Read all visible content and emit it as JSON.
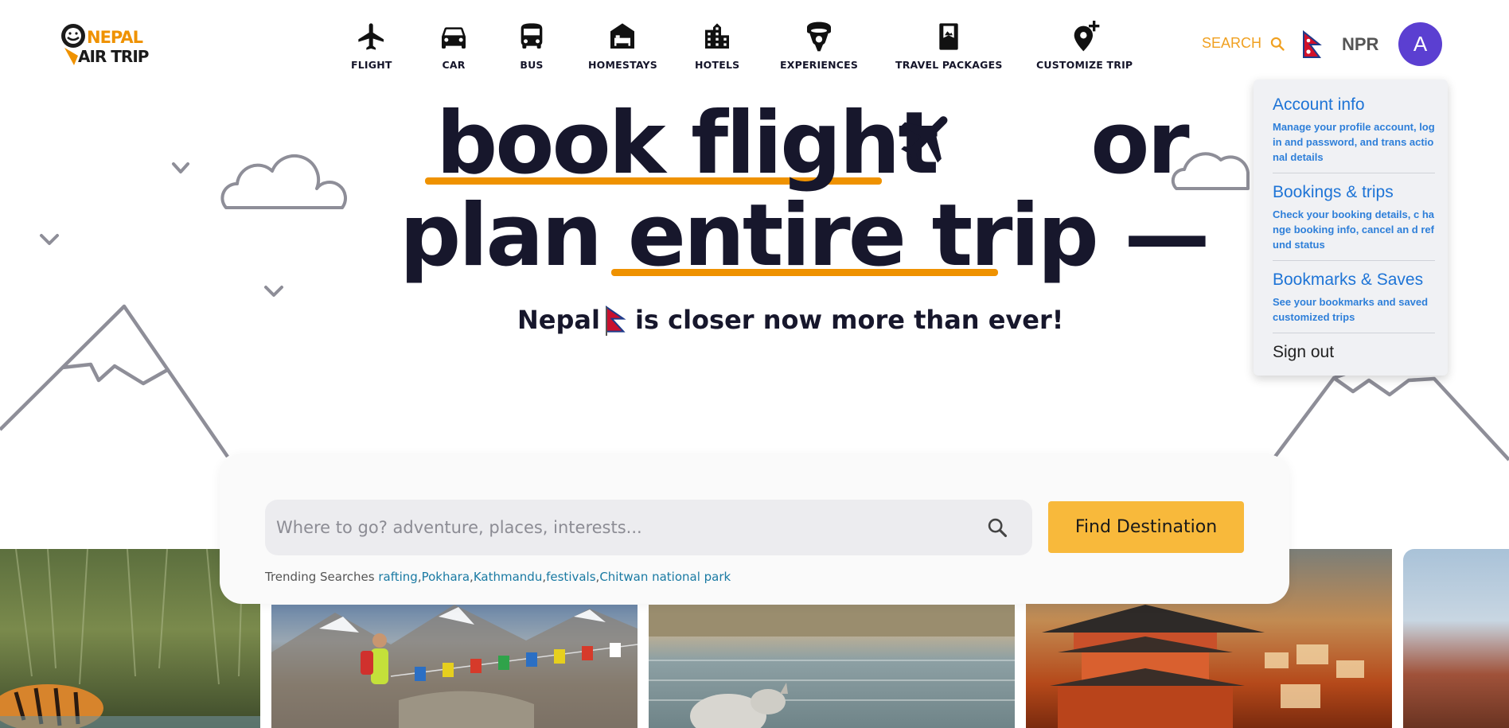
{
  "brand": {
    "logo_line1": "NEPAL",
    "logo_line2": "AIR TRIP",
    "accent": "#ef9200"
  },
  "nav": [
    {
      "label": "FLIGHT",
      "icon": "plane-icon"
    },
    {
      "label": "CAR",
      "icon": "car-icon"
    },
    {
      "label": "BUS",
      "icon": "bus-icon"
    },
    {
      "label": "HOMESTAYS",
      "icon": "homestay-icon"
    },
    {
      "label": "HOTELS",
      "icon": "hotel-icon"
    },
    {
      "label": "EXPERIENCES",
      "icon": "experiences-icon"
    },
    {
      "label": "TRAVEL PACKAGES",
      "icon": "travel-packages-icon"
    },
    {
      "label": "CUSTOMIZE TRIP",
      "icon": "customize-trip-icon"
    }
  ],
  "header": {
    "search_label": "SEARCH",
    "currency": "NPR",
    "avatar_letter": "A"
  },
  "account_menu": {
    "items": [
      {
        "title": "Account info",
        "desc": "Manage your profile account, login and password, and trans actional details"
      },
      {
        "title": "Bookings & trips",
        "desc": "Check your booking details, c hange booking info, cancel an d refund status"
      },
      {
        "title": "Bookmarks & Saves",
        "desc": "See your bookmarks and saved customized trips"
      }
    ],
    "signout": "Sign out"
  },
  "hero": {
    "line1_a": "book flight",
    "line1_b": "or",
    "line2_a": "plan",
    "line2_b": "entire trip",
    "line2_c": "—",
    "tagline_a": "Nepal",
    "tagline_b": "is closer now more than ever!"
  },
  "search": {
    "placeholder": "Where to go? adventure, places, interests...",
    "value": "",
    "button": "Find Destination",
    "trending_label": "Trending Searches",
    "trending": [
      "rafting",
      "Pokhara",
      "Kathmandu",
      "festivals",
      "Chitwan national park"
    ]
  },
  "photos": [
    "tiger-photo",
    "trekker-photo",
    "rhino-photo",
    "temple-photo",
    "city-photo"
  ]
}
